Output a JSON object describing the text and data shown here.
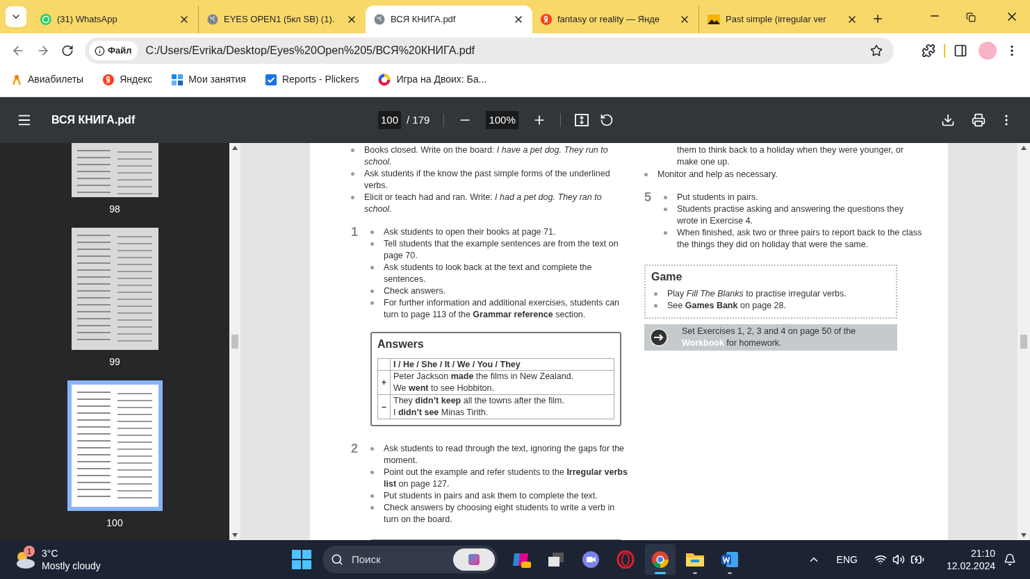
{
  "browser": {
    "tabs": [
      {
        "title": "(31) WhatsApp",
        "selected": false
      },
      {
        "title": "EYES OPEN1 (5кл SB) (1).",
        "selected": false
      },
      {
        "title": "ВСЯ КНИГА.pdf",
        "selected": true
      },
      {
        "title": "fantasy or reality — Янде",
        "selected": false
      },
      {
        "title": "Past simple (irregular ver",
        "selected": false
      }
    ],
    "chip": "Файл",
    "address": "C:/Users/Evrika/Desktop/Eyes%20Open%205/ВСЯ%20КНИГА.pdf",
    "bookmarks": [
      {
        "label": "Авиабилеты"
      },
      {
        "label": "Яндекс"
      },
      {
        "label": "Мои занятия"
      },
      {
        "label": "Reports - Plickers"
      },
      {
        "label": "Игра на Двоих: Ба..."
      }
    ]
  },
  "pdf": {
    "title": "ВСЯ КНИГА.pdf",
    "page": "100",
    "total": "/ 179",
    "zoom": "100%",
    "thumbnails": [
      {
        "label": "98",
        "selected": false
      },
      {
        "label": "99",
        "selected": false
      },
      {
        "label": "100",
        "selected": true
      }
    ]
  },
  "page": {
    "left": [
      {
        "kind": "bullets",
        "items": [
          "Books closed. Write on the board: *I have a pet dog. They run to school.*",
          "Ask students if the know the past simple forms of the underlined verbs.",
          "Elicit or teach had and ran. Write: *I had a pet dog. They ran to school.*"
        ]
      },
      {
        "kind": "bullets",
        "number": "1",
        "items": [
          "Ask students to open their books at page 71.",
          "Tell students that the example sentences are from the text on page 70.",
          "Ask students to look back at the text and complete the sentences.",
          "Check answers.",
          "For further information and additional exercises, students can turn to page 113 of the **Grammar reference** section."
        ]
      },
      {
        "kind": "answers",
        "title": "Answers",
        "header": "I / He / She / It / We / You / They",
        "rows": [
          {
            "sign": "+",
            "lines": [
              "Peter Jackson **made** the films in New Zealand.",
              "We **went** to see Hobbiton."
            ]
          },
          {
            "sign": "–",
            "lines": [
              "They **didn’t keep** all the towns after the film.",
              "I **didn’t see** Minas Tirith."
            ]
          }
        ]
      },
      {
        "kind": "bullets",
        "number": "2",
        "items": [
          "Ask students to read through the text, ignoring the gaps for the moment.",
          "Point out the example and refer students to the **Irregular verbs list** on page 127.",
          "Put students in pairs and ask them to complete the text.",
          "Check answers by choosing eight students to write a verb in turn on the board."
        ]
      },
      {
        "kind": "cutbox"
      }
    ],
    "right": [
      {
        "kind": "continuation",
        "text": "them to think back to a holiday when they were younger, or make one up."
      },
      {
        "kind": "bullets",
        "items": [
          "Monitor and help as necessary."
        ]
      },
      {
        "kind": "bullets",
        "number": "5",
        "items": [
          "Put students in pairs.",
          "Students practise asking and answering the questions they wrote in Exercise 4.",
          "When finished, ask two or three pairs to report back to the class the things they did on holiday that were the same."
        ]
      },
      {
        "kind": "game",
        "title": "Game",
        "items": [
          "Play *Fill The Blanks* to practise irregular verbs.",
          "See **Games Bank** on page 28."
        ]
      },
      {
        "kind": "homework",
        "text": "Set Exercises 1, 2, 3 and 4 on page 50 of the **Workbook** for homework."
      }
    ]
  },
  "taskbar": {
    "temp": "3°C",
    "weather": "Mostly cloudy",
    "badge": "1",
    "search": "Поиск",
    "apps": [
      {
        "kind": "copilot",
        "selected": false,
        "running": false
      },
      {
        "kind": "taskview",
        "selected": false,
        "running": false
      },
      {
        "kind": "meet",
        "selected": false,
        "running": false
      },
      {
        "kind": "opera",
        "selected": false,
        "running": false
      },
      {
        "kind": "chrome",
        "selected": true,
        "running": true
      },
      {
        "kind": "files",
        "selected": false,
        "running": true
      },
      {
        "kind": "word",
        "selected": false,
        "running": true
      }
    ],
    "lang": "ENG",
    "time": "21:10",
    "date": "12.02.2024"
  }
}
